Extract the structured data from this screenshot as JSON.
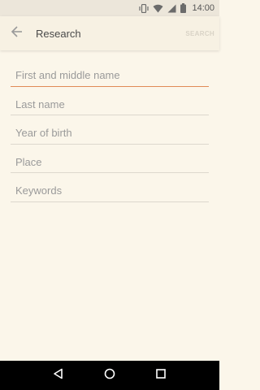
{
  "status_bar": {
    "time": "14:00",
    "icons": [
      "vibrate-icon",
      "wifi-icon",
      "signal-icon",
      "battery-icon"
    ]
  },
  "toolbar": {
    "back_icon": "arrow-left-icon",
    "title": "Research",
    "action_label": "SEARCH"
  },
  "form": {
    "fields": [
      {
        "placeholder": "First and middle name",
        "value": "",
        "focused": true
      },
      {
        "placeholder": "Last name",
        "value": ""
      },
      {
        "placeholder": "Year of birth",
        "value": ""
      },
      {
        "placeholder": "Place",
        "value": ""
      },
      {
        "placeholder": "Keywords",
        "value": ""
      }
    ]
  },
  "nav_bar": {
    "icons": [
      "back-triangle-icon",
      "home-circle-icon",
      "recents-square-icon"
    ]
  },
  "colors": {
    "background": "#fbf6ea",
    "focus_underline": "#e08a56",
    "action_disabled": "#d9d3c6"
  }
}
